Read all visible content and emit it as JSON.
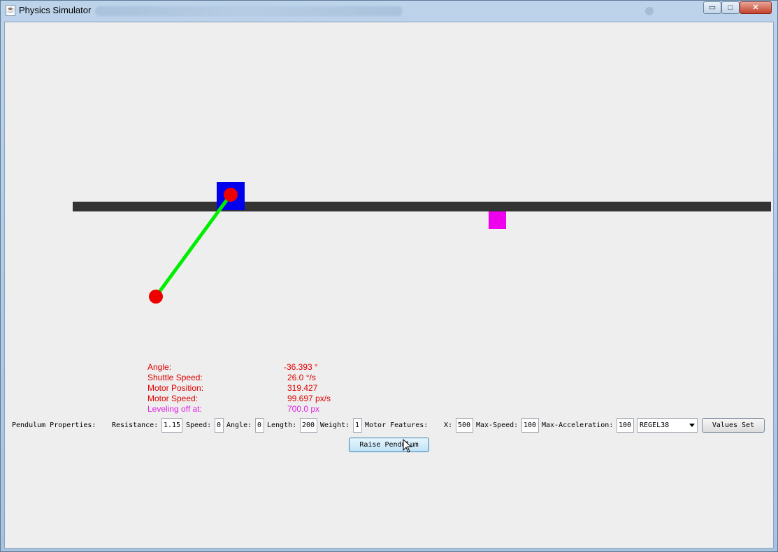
{
  "window": {
    "title": "Physics Simulator",
    "controls": {
      "minimize": "▭",
      "maximize": "□",
      "close": "✕"
    }
  },
  "readouts": {
    "angle_label": "Angle:",
    "angle_value": "-36.393 °",
    "shuttle_speed_label": "Shuttle Speed:",
    "shuttle_speed_value": "26.0 °/s",
    "motor_position_label": "Motor Position:",
    "motor_position_value": "319.427",
    "motor_speed_label": "Motor Speed:",
    "motor_speed_value": "99.697 px/s",
    "leveling_label": "Leveling off at:",
    "leveling_value": "700.0 px"
  },
  "properties": {
    "section_label": "Pendulum Properties:",
    "resistance_label": "Resistance:",
    "resistance_value": "1.15",
    "speed_label": "Speed:",
    "speed_value": "0",
    "angle_label": "Angle:",
    "angle_value": "0",
    "length_label": "Length:",
    "length_value": "200",
    "weight_label": "Weight:",
    "weight_value": "1",
    "motor_section_label": "Motor Features:",
    "x_label": "X:",
    "x_value": "500",
    "max_speed_label": "Max-Speed:",
    "max_speed_value": "100",
    "max_accel_label": "Max-Acceleration:",
    "max_accel_value": "100",
    "controller_selected": "REGEL38",
    "values_set_label": "Values Set"
  },
  "actions": {
    "raise_label": "Raise Pendulum"
  },
  "colors": {
    "rail": "#333333",
    "shuttle": "#0000ee",
    "pivot": "#ee0000",
    "rod": "#00ee00",
    "bob": "#ee0000",
    "leveling_marker": "#ee00ee",
    "readout_text": "#e00000",
    "leveling_text": "#e020e0"
  }
}
